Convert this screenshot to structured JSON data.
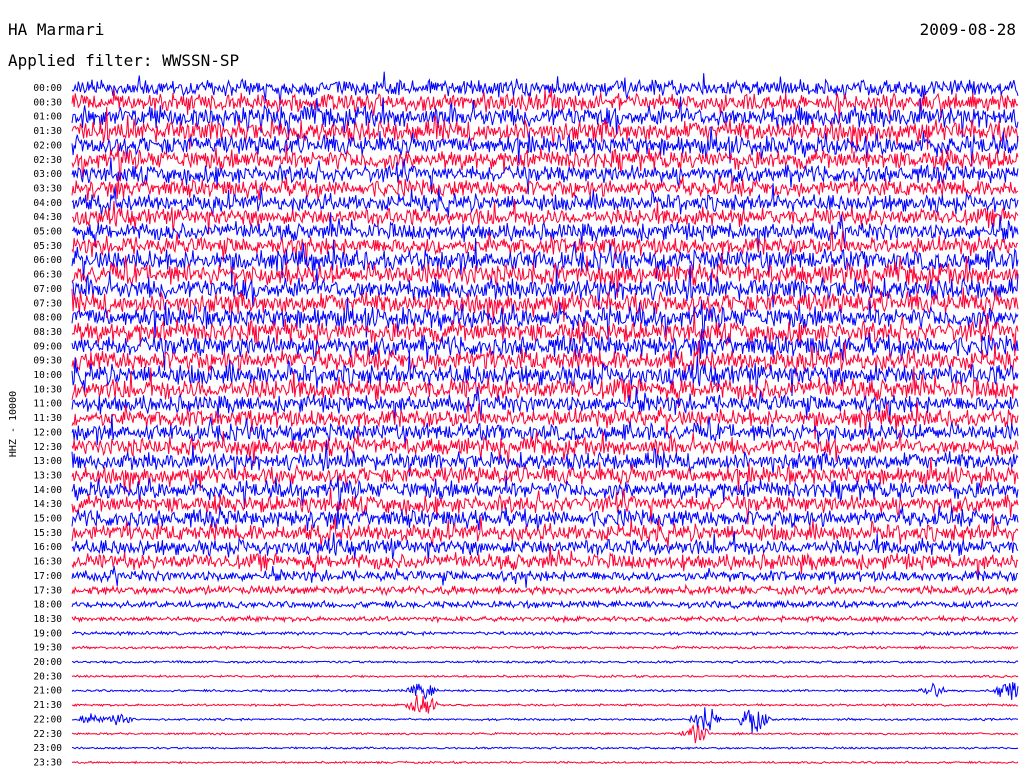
{
  "header": {
    "station": "HA Marmari",
    "date": "2009-08-28",
    "filter": "Applied filter: WWSSN-SP"
  },
  "chart_data": {
    "type": "line",
    "title": "HA Marmari",
    "subtitle": "Applied filter: WWSSN-SP",
    "ylabel": "HHZ - 10000",
    "xlabel": "",
    "colors": [
      "#0000ff",
      "#ff0033"
    ],
    "grid": false,
    "legend": "none",
    "categories": [
      "00:00",
      "00:30",
      "01:00",
      "01:30",
      "02:00",
      "02:30",
      "03:00",
      "03:30",
      "04:00",
      "04:30",
      "05:00",
      "05:30",
      "06:00",
      "06:30",
      "07:00",
      "07:30",
      "08:00",
      "08:30",
      "09:00",
      "09:30",
      "10:00",
      "10:30",
      "11:00",
      "11:30",
      "12:00",
      "12:30",
      "13:00",
      "13:30",
      "14:00",
      "14:30",
      "15:00",
      "15:30",
      "16:00",
      "16:30",
      "17:00",
      "17:30",
      "18:00",
      "18:30",
      "19:00",
      "19:30",
      "20:00",
      "20:30",
      "21:00",
      "21:30",
      "22:00",
      "22:30",
      "23:00",
      "23:30"
    ],
    "noise_amplitude": [
      9,
      10,
      12,
      12,
      11,
      11,
      10,
      10,
      10,
      10,
      10,
      10,
      12,
      12,
      12,
      12,
      12,
      12,
      12,
      12,
      12,
      12,
      10,
      10,
      10,
      10,
      10,
      10,
      10,
      10,
      10,
      10,
      9,
      9,
      6,
      5,
      4,
      3,
      2,
      1.5,
      1.4,
      1.3,
      1.3,
      1.3,
      1.3,
      1.2,
      1.2,
      1.2
    ],
    "events": [
      {
        "row": 19,
        "position": 0.39,
        "amplitude": 9
      },
      {
        "row": 19,
        "position": 0.44,
        "amplitude": 10
      },
      {
        "row": 19,
        "position": 0.53,
        "amplitude": 8
      },
      {
        "row": 19,
        "position": 0.58,
        "amplitude": 7
      },
      {
        "row": 20,
        "position": 0.55,
        "amplitude": 10
      },
      {
        "row": 42,
        "position": 0.37,
        "amplitude": 10
      },
      {
        "row": 42,
        "position": 0.91,
        "amplitude": 8
      },
      {
        "row": 42,
        "position": 0.99,
        "amplitude": 12
      },
      {
        "row": 43,
        "position": 0.37,
        "amplitude": 14
      },
      {
        "row": 44,
        "position": 0.02,
        "amplitude": 7
      },
      {
        "row": 44,
        "position": 0.05,
        "amplitude": 7
      },
      {
        "row": 44,
        "position": 0.67,
        "amplitude": 16
      },
      {
        "row": 44,
        "position": 0.72,
        "amplitude": 16
      },
      {
        "row": 45,
        "position": 0.66,
        "amplitude": 10
      }
    ]
  }
}
